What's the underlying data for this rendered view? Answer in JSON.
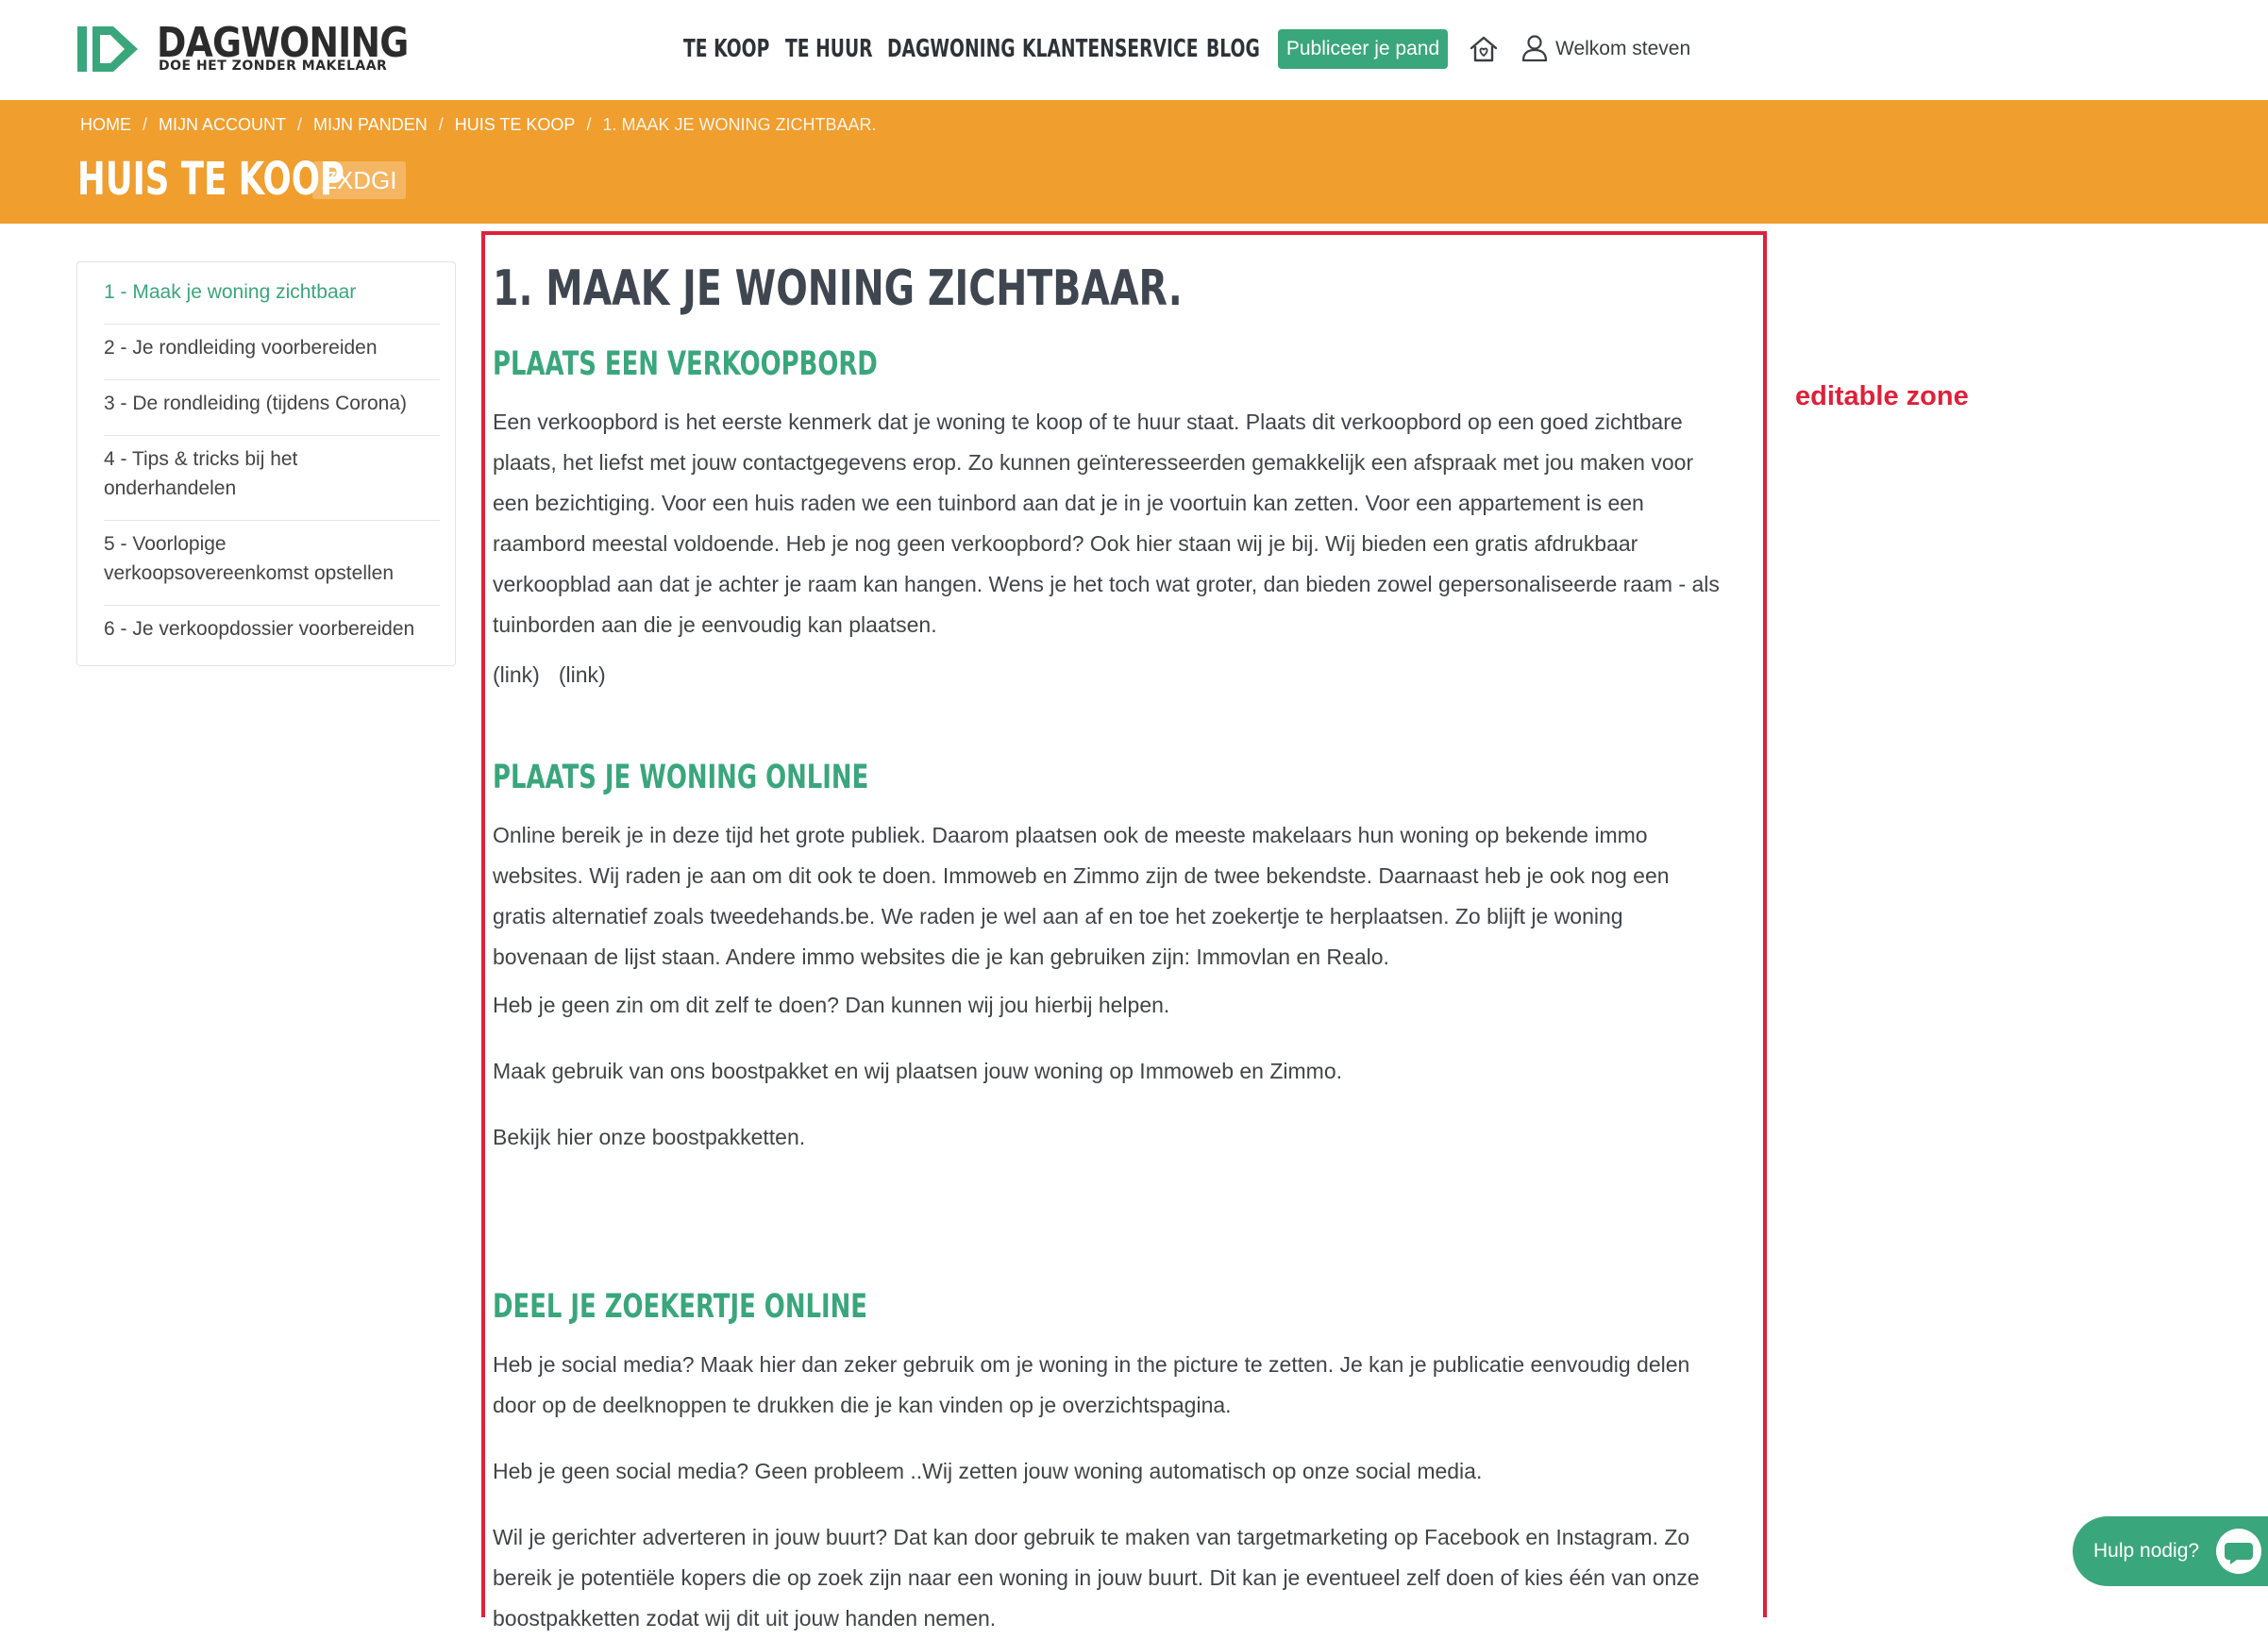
{
  "brand": {
    "name": "DAGWONING",
    "tagline": "DOE HET ZONDER MAKELAAR",
    "green": "#3aa67c",
    "orange": "#f09e2e"
  },
  "nav": {
    "items": [
      "TE KOOP",
      "TE HUUR",
      "DAGWONING",
      "KLANTENSERVICE",
      "BLOG"
    ],
    "publish_label": "Publiceer je pand",
    "welcome": "Welkom steven"
  },
  "banner": {
    "breadcrumb": [
      "HOME",
      "MIJN ACCOUNT",
      "MIJN PANDEN",
      "HUIS TE KOOP",
      "1. MAAK JE WONING ZICHTBAAR."
    ],
    "separator": "/",
    "title": "HUIS TE KOOP",
    "code": "ZXDGI"
  },
  "sidebar": {
    "items": [
      "1 - Maak je woning zichtbaar",
      "2 - Je rondleiding voorbereiden",
      "3 - De rondleiding (tijdens Corona)",
      "4 - Tips & tricks bij het onderhandelen",
      "5 - Voorlopige verkoopsovereenkomst opstellen",
      "6 - Je verkoopdossier voorbereiden"
    ]
  },
  "annotation": {
    "zone_label": "editable zone",
    "zone_color": "#e0203a"
  },
  "content": {
    "title": "1. MAAK JE WONING ZICHTBAAR.",
    "sections": [
      {
        "heading": "PLAATS EEN VERKOOPBORD",
        "paragraphs": [
          "Een verkoopbord  is het eerste kenmerk dat je woning te koop of te huur staat. Plaats dit verkoopbord op een goed zichtbare plaats, het liefst met jouw contactgegevens erop. Zo kunnen geïnteresseerden gemakkelijk een afspraak met jou maken voor een bezichtiging. Voor een huis raden we een tuinbord aan dat je in je voortuin kan zetten. Voor een appartement is een raambord meestal voldoende. Heb je nog geen verkoopbord? Ook hier staan wij je bij. Wij bieden een gratis afdrukbaar verkoopblad aan dat je achter je raam kan hangen. Wens je het toch wat groter, dan bieden zowel gepersonaliseerde raam - als tuinborden aan die je eenvoudig kan plaatsen."
        ],
        "links": [
          "(link)",
          "(link)"
        ]
      },
      {
        "heading": "PLAATS JE WONING ONLINE",
        "paragraphs": [
          "Online bereik je in deze tijd het grote publiek. Daarom plaatsen ook de meeste makelaars hun woning op bekende immo websites. Wij raden je aan om dit ook te doen. Immoweb en Zimmo zijn de twee bekendste. Daarnaast heb je ook nog een gratis alternatief zoals tweedehands.be. We raden je wel aan af en toe het zoekertje te herplaatsen. Zo blijft je woning bovenaan de lijst staan.  Andere immo websites die je kan gebruiken zijn: Immovlan en Realo.",
          "Heb je geen zin om dit zelf te doen? Dan kunnen wij jou hierbij helpen.",
          "Maak gebruik van ons boostpakket en wij plaatsen jouw woning op Immoweb en Zimmo.",
          "Bekijk hier onze boostpakketten."
        ]
      },
      {
        "heading": "DEEL JE ZOEKERTJE ONLINE",
        "paragraphs": [
          "Heb je social media? Maak hier dan zeker gebruik om je woning in the picture te zetten. Je kan je publicatie eenvoudig delen door op de deelknoppen te drukken die je kan vinden op je overzichtspagina.",
          "Heb je geen social media? Geen probleem ..Wij zetten jouw woning automatisch op onze social media.",
          "Wil je gerichter adverteren in jouw buurt? Dat kan door gebruik te maken van targetmarketing op Facebook en Instagram. Zo bereik je potentiële kopers die op zoek zijn naar een woning in jouw buurt. Dit kan je eventueel zelf doen of kies één van onze boostpakketten zodat wij dit uit jouw handen nemen."
        ]
      }
    ]
  },
  "help": {
    "label": "Hulp nodig?",
    "icon": "chat-bubble-icon"
  }
}
